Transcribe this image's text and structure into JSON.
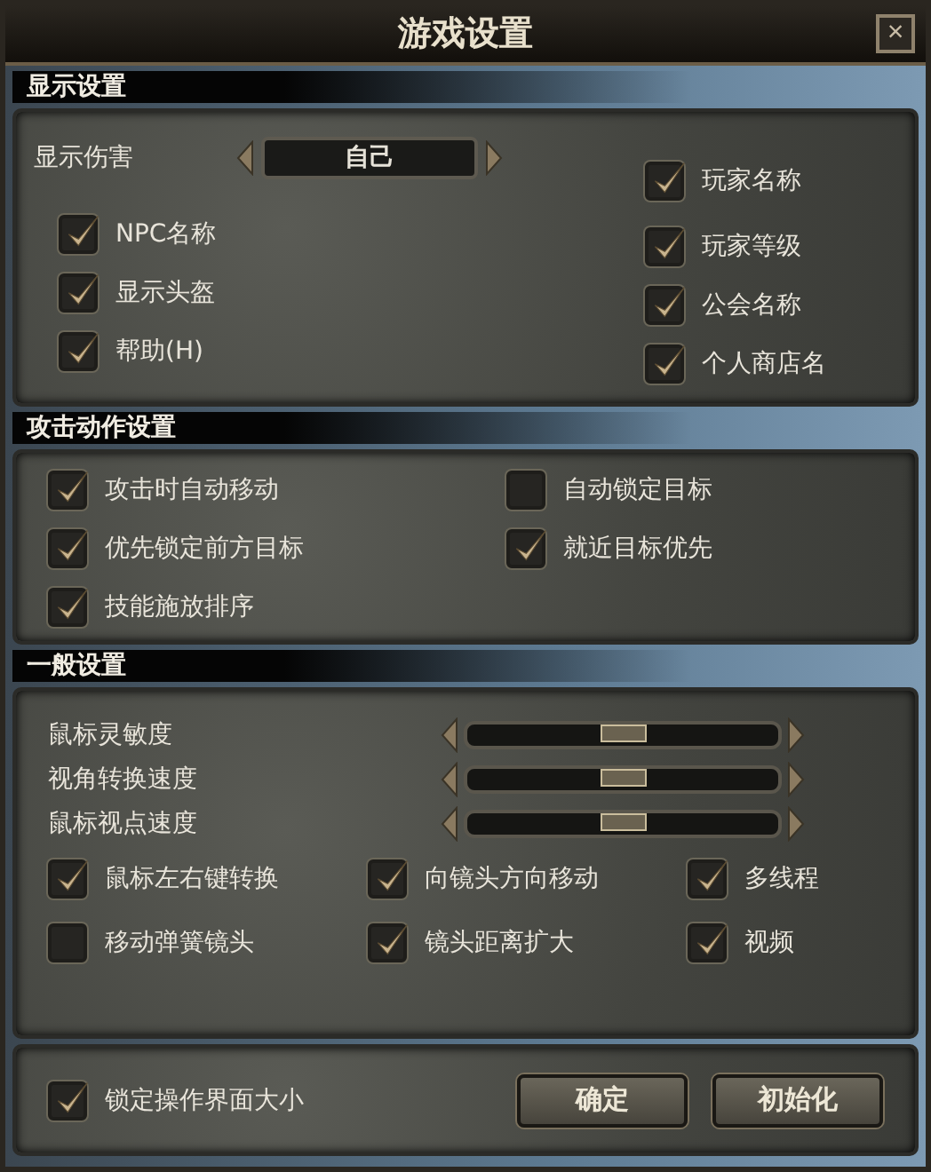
{
  "window": {
    "title": "游戏设置",
    "close": "×"
  },
  "display": {
    "header": "显示设置",
    "damage": {
      "label": "显示伤害",
      "value": "自己"
    },
    "left": [
      {
        "label": "NPC名称",
        "checked": true
      },
      {
        "label": "显示头盔",
        "checked": true
      },
      {
        "label": "帮助(H)",
        "checked": true
      }
    ],
    "right": [
      {
        "label": "玩家名称",
        "checked": true
      },
      {
        "label": "玩家等级",
        "checked": true
      },
      {
        "label": "公会名称",
        "checked": true
      },
      {
        "label": "个人商店名",
        "checked": true
      }
    ]
  },
  "attack": {
    "header": "攻击动作设置",
    "options": [
      {
        "label": "攻击时自动移动",
        "checked": true
      },
      {
        "label": "自动锁定目标",
        "checked": false
      },
      {
        "label": "优先锁定前方目标",
        "checked": true
      },
      {
        "label": "就近目标优先",
        "checked": true
      },
      {
        "label": "技能施放排序",
        "checked": true
      }
    ]
  },
  "general": {
    "header": "一般设置",
    "sliders": [
      {
        "label": "鼠标灵敏度",
        "level": 0.5
      },
      {
        "label": "视角转换速度",
        "level": 0.5
      },
      {
        "label": "鼠标视点速度",
        "level": 0.5
      }
    ],
    "options": [
      {
        "label": "鼠标左右键转换",
        "checked": true
      },
      {
        "label": "向镜头方向移动",
        "checked": true
      },
      {
        "label": "多线程",
        "checked": true
      },
      {
        "label": "移动弹簧镜头",
        "checked": false
      },
      {
        "label": "镜头距离扩大",
        "checked": true
      },
      {
        "label": "视频",
        "checked": true
      }
    ]
  },
  "footer": {
    "lock": {
      "label": "锁定操作界面大小",
      "checked": true
    },
    "buttons": [
      "确定",
      "初始化"
    ]
  }
}
